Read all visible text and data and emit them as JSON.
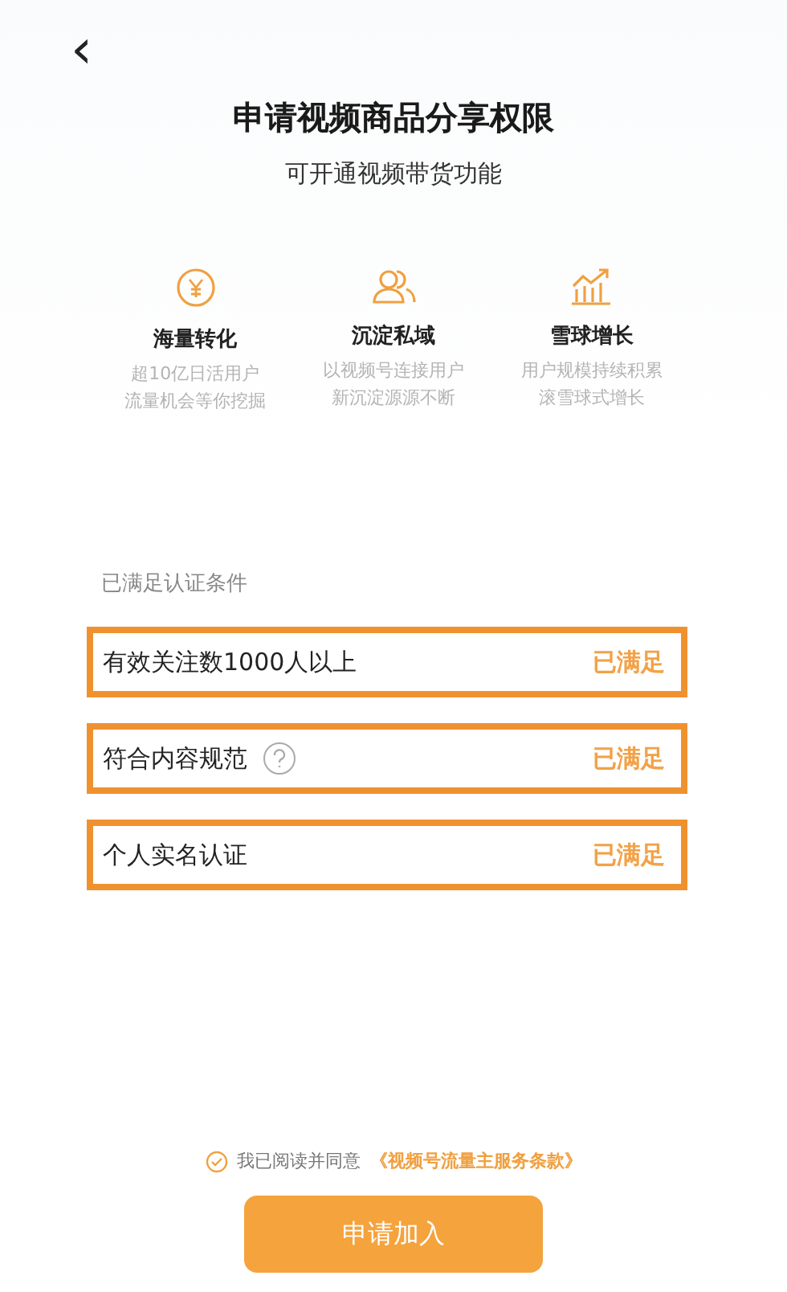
{
  "header": {
    "back": "‹",
    "title": "申请视频商品分享权限",
    "subtitle": "可开通视频带货功能"
  },
  "features": [
    {
      "kind": "yen",
      "title": "海量转化",
      "lines": [
        "超10亿日活用户",
        "流量机会等你挖掘"
      ]
    },
    {
      "kind": "users",
      "title": "沉淀私域",
      "lines": [
        "以视频号连接用户",
        "新沉淀源源不断"
      ]
    },
    {
      "kind": "growth",
      "title": "雪球增长",
      "lines": [
        "用户规模持续积累",
        "滚雪球式增长"
      ]
    }
  ],
  "conditions": {
    "label": "已满足认证条件",
    "rows": [
      {
        "text": "有效关注数1000人以上",
        "help": false,
        "status": "已满足",
        "highlighted": true
      },
      {
        "text": "符合内容规范",
        "help": true,
        "status": "已满足",
        "highlighted": true
      },
      {
        "text": "个人实名认证",
        "help": false,
        "status": "已满足",
        "highlighted": true
      }
    ]
  },
  "agreement": {
    "checked": true,
    "text": "我已阅读并同意",
    "link": "《视频号流量主服务条款》"
  },
  "button": "申请加入"
}
